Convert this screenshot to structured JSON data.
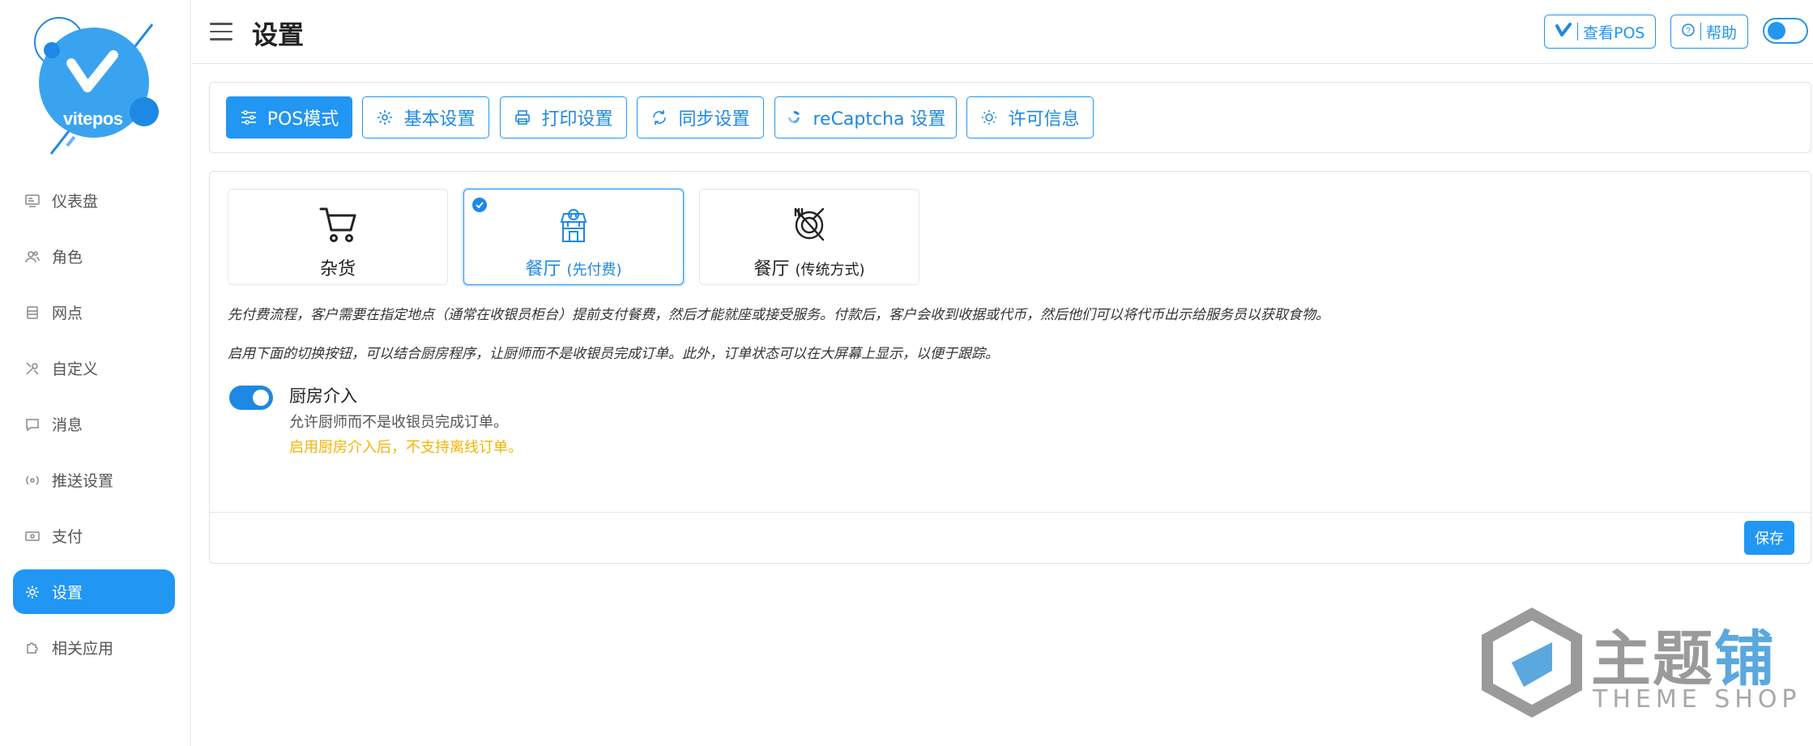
{
  "logo": {
    "text": "vitepos"
  },
  "sidebar": {
    "items": [
      {
        "label": "仪表盘",
        "icon": "dashboard-icon"
      },
      {
        "label": "角色",
        "icon": "users-icon"
      },
      {
        "label": "网点",
        "icon": "store-icon"
      },
      {
        "label": "自定义",
        "icon": "tools-icon"
      },
      {
        "label": "消息",
        "icon": "message-icon"
      },
      {
        "label": "推送设置",
        "icon": "broadcast-icon"
      },
      {
        "label": "支付",
        "icon": "payment-icon"
      },
      {
        "label": "设置",
        "icon": "gear-icon",
        "active": true
      },
      {
        "label": "相关应用",
        "icon": "puzzle-icon"
      }
    ]
  },
  "header": {
    "title": "设置",
    "view_pos": "查看POS",
    "help": "帮助"
  },
  "tabs": [
    {
      "label": "POS模式",
      "icon": "sliders-icon",
      "active": true
    },
    {
      "label": "基本设置",
      "icon": "gear-icon"
    },
    {
      "label": "打印设置",
      "icon": "printer-icon"
    },
    {
      "label": "同步设置",
      "icon": "sync-icon"
    },
    {
      "label": "reCaptcha 设置",
      "icon": "recaptcha-icon"
    },
    {
      "label": "许可信息",
      "icon": "sun-icon"
    }
  ],
  "modes": [
    {
      "label": "杂货",
      "sub": "",
      "icon": "cart-icon",
      "selected": false
    },
    {
      "label": "餐厅",
      "sub": "(先付费)",
      "icon": "restaurant-icon",
      "selected": true
    },
    {
      "label": "餐厅",
      "sub": "(传统方式)",
      "icon": "dining-icon",
      "selected": false
    }
  ],
  "descriptions": {
    "line1": "先付费流程，客户需要在指定地点（通常在收银员柜台）提前支付餐费，然后才能就座或接受服务。付款后，客户会收到收据或代币，然后他们可以将代币出示给服务员以获取食物。",
    "line2": "启用下面的切换按钮，可以结合厨房程序，让厨师而不是收银员完成订单。此外，订单状态可以在大屏幕上显示，以便于跟踪。"
  },
  "kitchen": {
    "title": "厨房介入",
    "enabled": true,
    "subtitle": "允许厨师而不是收银员完成订单。",
    "warning": "启用厨房介入后，不支持离线订单。"
  },
  "save_label": "保存",
  "watermark": {
    "cn_a": "主题",
    "cn_b": "铺",
    "en": "THEME SHOP"
  },
  "colors": {
    "accent": "#2196f3",
    "warning": "#f5b400"
  }
}
